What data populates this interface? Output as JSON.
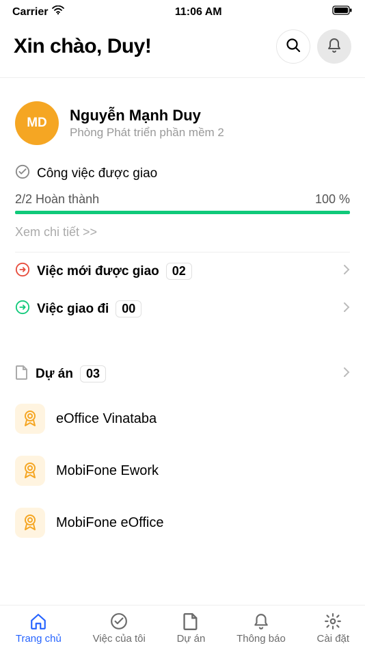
{
  "status": {
    "carrier": "Carrier",
    "time": "11:06 AM"
  },
  "header": {
    "greeting": "Xin chào, Duy!"
  },
  "user": {
    "initials": "MD",
    "name": "Nguyễn Mạnh Duy",
    "dept": "Phòng Phát triển phần mềm 2"
  },
  "assigned": {
    "title": "Công việc được giao",
    "progress_label": "2/2 Hoàn thành",
    "percent": "100 %",
    "view_more": "Xem chi tiết >>"
  },
  "links": {
    "new_assigned": {
      "label": "Việc mới được giao",
      "count": "02"
    },
    "delegated": {
      "label": "Việc giao đi",
      "count": "00"
    }
  },
  "projects": {
    "title": "Dự án",
    "count": "03",
    "items": [
      {
        "name": "eOffice Vinataba"
      },
      {
        "name": "MobiFone Ework"
      },
      {
        "name": "MobiFone eOffice"
      }
    ]
  },
  "tabs": {
    "home": "Trang chủ",
    "mywork": "Việc của tôi",
    "projects": "Dự án",
    "notif": "Thông báo",
    "settings": "Cài đặt"
  }
}
